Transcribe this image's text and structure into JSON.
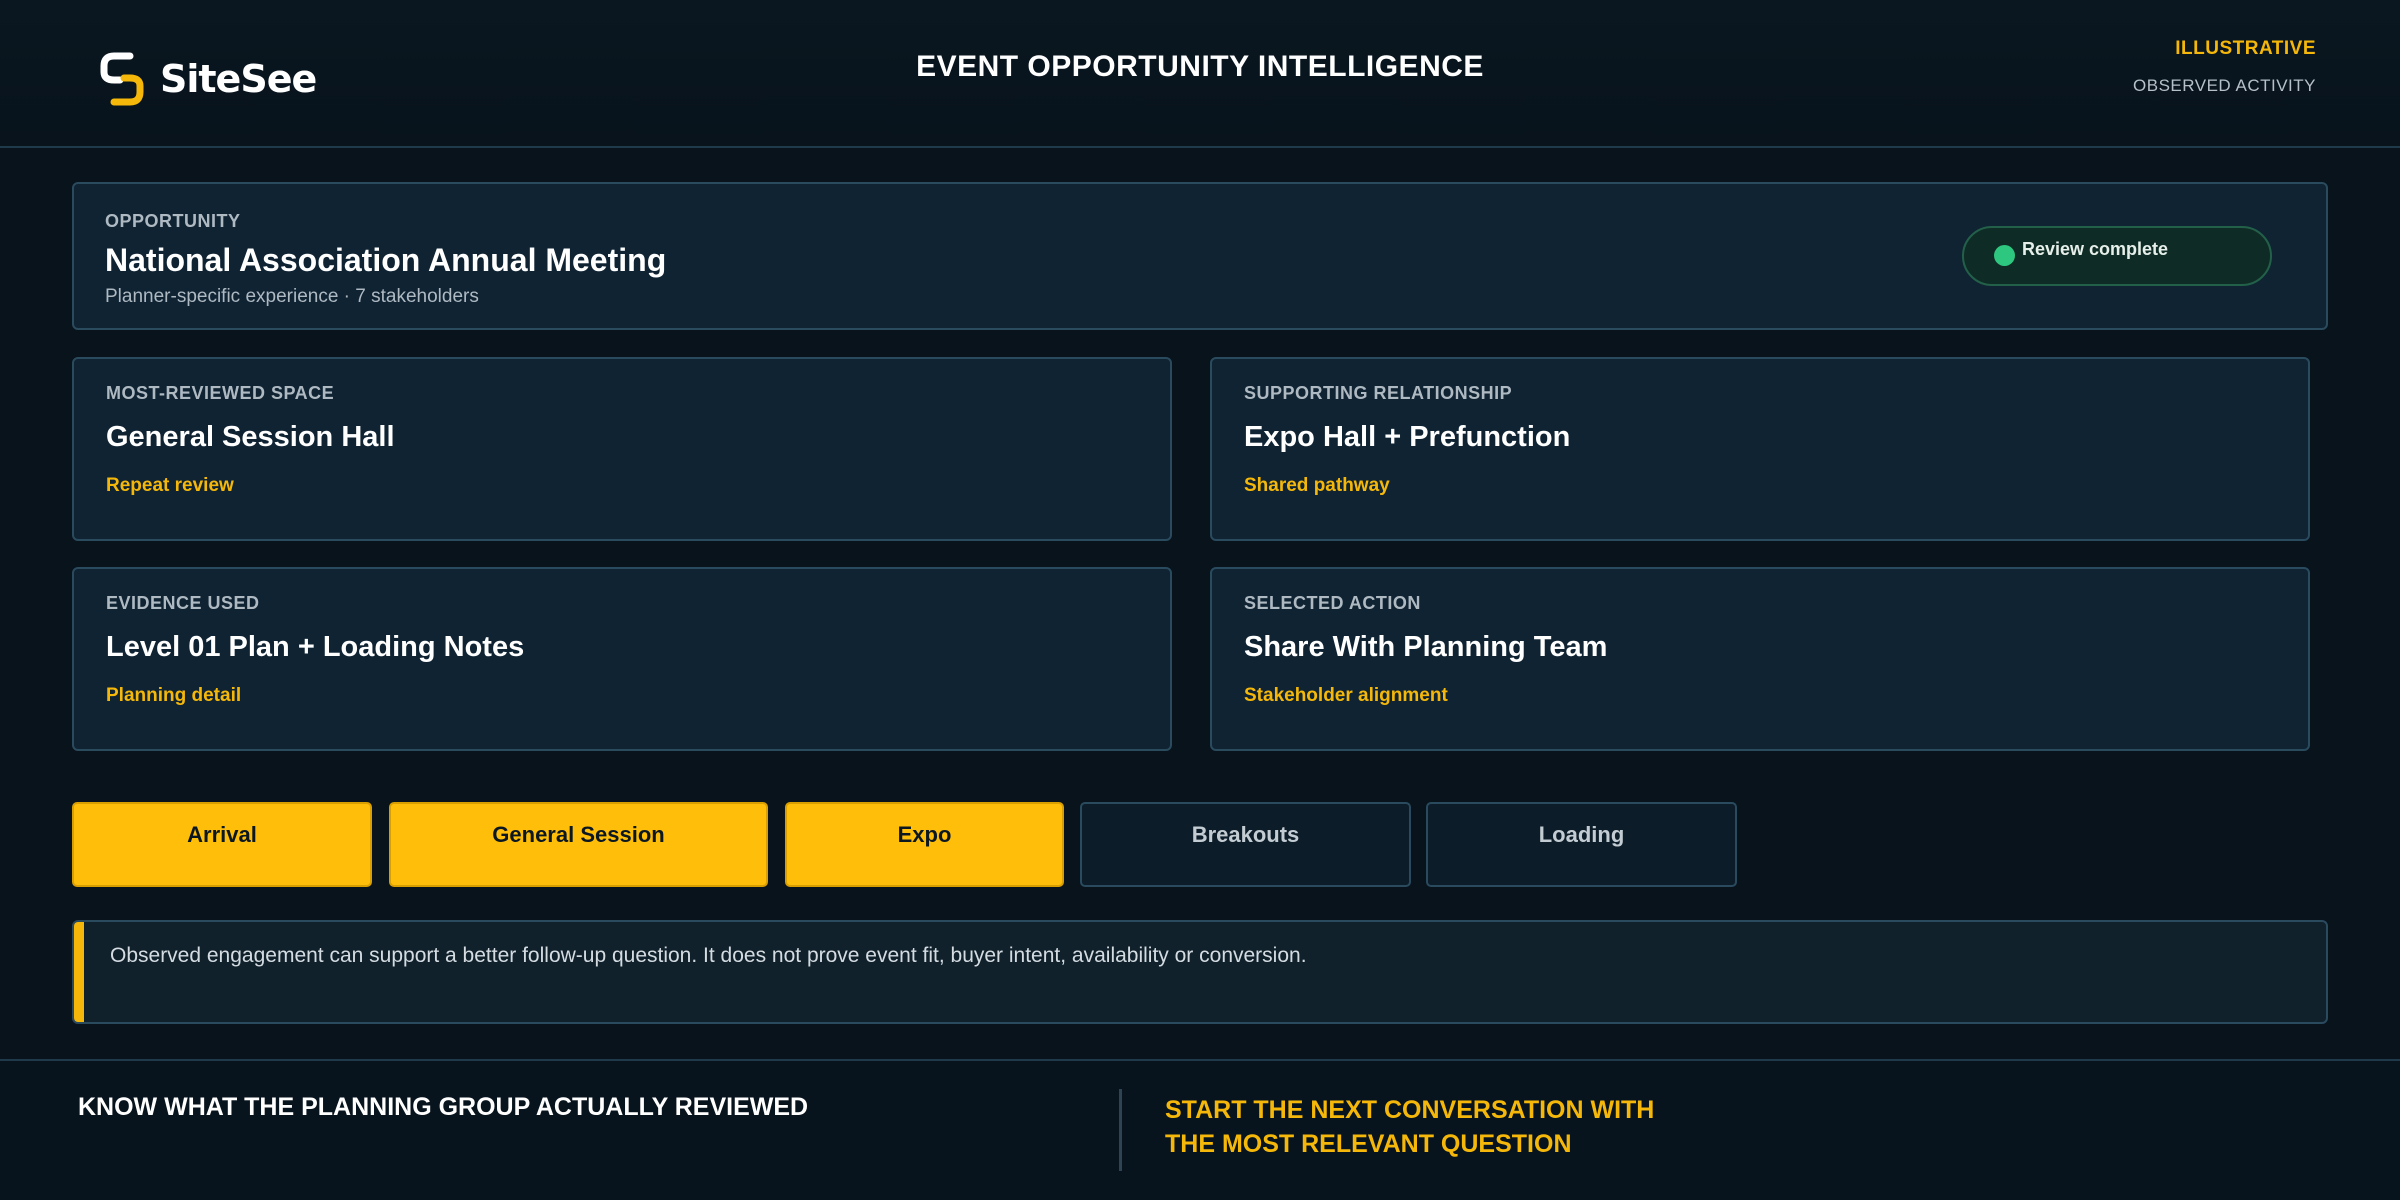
{
  "header": {
    "brand": "SiteSee",
    "title": "EVENT OPPORTUNITY INTELLIGENCE",
    "badge": "ILLUSTRATIVE",
    "subbadge": "OBSERVED ACTIVITY"
  },
  "opportunity": {
    "label": "OPPORTUNITY",
    "title": "National Association Annual Meeting",
    "subtitle": "Planner-specific experience · 7 stakeholders",
    "status": "Review complete",
    "status_color": "#2ec77f"
  },
  "cards": {
    "space": {
      "label": "MOST-REVIEWED SPACE",
      "title": "General Session Hall",
      "tag": "Repeat review"
    },
    "relationship": {
      "label": "SUPPORTING RELATIONSHIP",
      "title": "Expo Hall + Prefunction",
      "tag": "Shared pathway"
    },
    "evidence": {
      "label": "EVIDENCE USED",
      "title": "Level 01 Plan + Loading Notes",
      "tag": "Planning detail"
    },
    "action": {
      "label": "SELECTED ACTION",
      "title": "Share With Planning Team",
      "tag": "Stakeholder alignment"
    }
  },
  "tabs": [
    {
      "label": "Arrival",
      "active": true
    },
    {
      "label": "General Session",
      "active": true
    },
    {
      "label": "Expo",
      "active": true
    },
    {
      "label": "Breakouts",
      "active": false
    },
    {
      "label": "Loading",
      "active": false
    }
  ],
  "notice": {
    "text": "Observed engagement can support a better follow-up question. It does not prove event fit, buyer intent, availability or conversion."
  },
  "footer": {
    "left": "KNOW WHAT THE PLANNING GROUP ACTUALLY REVIEWED",
    "right_line1": "START THE NEXT CONVERSATION WITH",
    "right_line2": "THE MOST RELEVANT QUESTION"
  },
  "colors": {
    "accent": "#f5b80a",
    "background": "#08131c",
    "card": "#0f2333",
    "success": "#2ec77f"
  }
}
